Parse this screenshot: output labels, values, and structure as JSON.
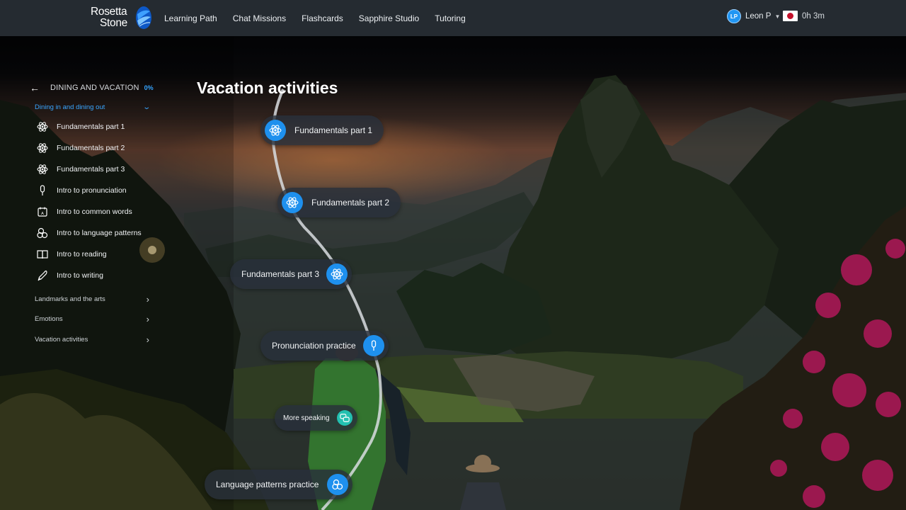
{
  "brand": {
    "line1": "Rosetta",
    "line2": "Stone"
  },
  "nav": {
    "items": [
      "Learning Path",
      "Chat Missions",
      "Flashcards",
      "Sapphire Studio",
      "Tutoring"
    ]
  },
  "user": {
    "initials": "LP",
    "name": "Leon P",
    "flag": "japan-flag-icon",
    "timer": "0h 3m"
  },
  "sidebar": {
    "unit_title": "DINING AND VACATION",
    "unit_progress": "0%",
    "open_section": "Dining in and dining out",
    "lessons": [
      {
        "label": "Fundamentals part 1",
        "icon": "atom-icon"
      },
      {
        "label": "Fundamentals part 2",
        "icon": "atom-icon"
      },
      {
        "label": "Fundamentals part 3",
        "icon": "atom-icon"
      },
      {
        "label": "Intro to pronunciation",
        "icon": "microphone-icon"
      },
      {
        "label": "Intro to common words",
        "icon": "calendar-word-icon"
      },
      {
        "label": "Intro to language patterns",
        "icon": "puzzle-circles-icon"
      },
      {
        "label": "Intro to reading",
        "icon": "book-icon"
      },
      {
        "label": "Intro to writing",
        "icon": "pen-icon"
      }
    ],
    "sections": [
      "Landmarks and the arts",
      "Emotions",
      "Vacation activities"
    ]
  },
  "main": {
    "title": "Vacation activities",
    "path_nodes": [
      {
        "label": "Fundamentals part 1",
        "icon": "atom-icon"
      },
      {
        "label": "Fundamentals part 2",
        "icon": "atom-icon"
      },
      {
        "label": "Fundamentals part 3",
        "icon": "atom-icon"
      },
      {
        "label": "Pronunciation practice",
        "icon": "microphone-icon"
      },
      {
        "label": "More speaking",
        "icon": "speech-bubbles-icon"
      },
      {
        "label": "Language patterns practice",
        "icon": "puzzle-circles-icon"
      }
    ]
  },
  "colors": {
    "accent": "#1e90ee",
    "teal": "#23c0b0",
    "topbar": "#252b31"
  }
}
